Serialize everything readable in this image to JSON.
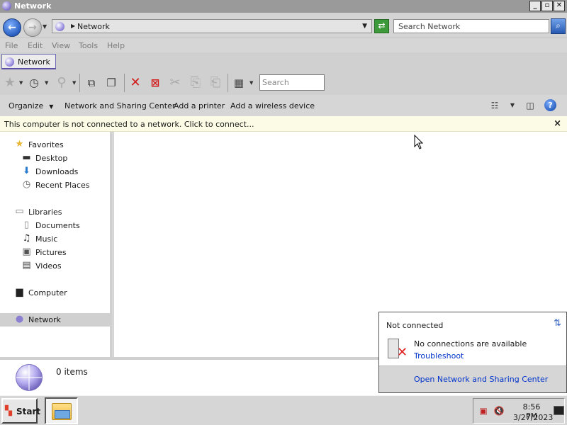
{
  "window": {
    "title": "Network",
    "minimize": "_",
    "maximize": "▫",
    "close": "✕"
  },
  "address": {
    "path": "Network",
    "search_placeholder": "Search Network"
  },
  "menu": {
    "file": "File",
    "edit": "Edit",
    "view": "View",
    "tools": "Tools",
    "help": "Help"
  },
  "tab": {
    "label": "Network"
  },
  "toolbar": {
    "search_placeholder": "Search"
  },
  "commands": {
    "organize": "Organize",
    "network_sharing": "Network and Sharing Center",
    "add_printer": "Add a printer",
    "add_wireless": "Add a wireless device"
  },
  "infobar": {
    "message": "This computer is not connected to a network. Click to connect...",
    "close": "×"
  },
  "navpane": {
    "favorites": "Favorites",
    "desktop": "Desktop",
    "downloads": "Downloads",
    "recent": "Recent Places",
    "libraries": "Libraries",
    "documents": "Documents",
    "music": "Music",
    "pictures": "Pictures",
    "videos": "Videos",
    "computer": "Computer",
    "network": "Network"
  },
  "details": {
    "count": "0 items"
  },
  "taskbar": {
    "start": "Start",
    "time": "8:56 PM",
    "date": "3/27/2023"
  },
  "popup": {
    "status": "Not connected",
    "message": "No connections are available",
    "troubleshoot": "Troubleshoot",
    "open_center": "Open Network and Sharing Center"
  },
  "colors": {
    "accent": "#5b4fa3",
    "link": "#0033cc",
    "error": "#e02020",
    "info_bg": "#fbfbe6"
  }
}
